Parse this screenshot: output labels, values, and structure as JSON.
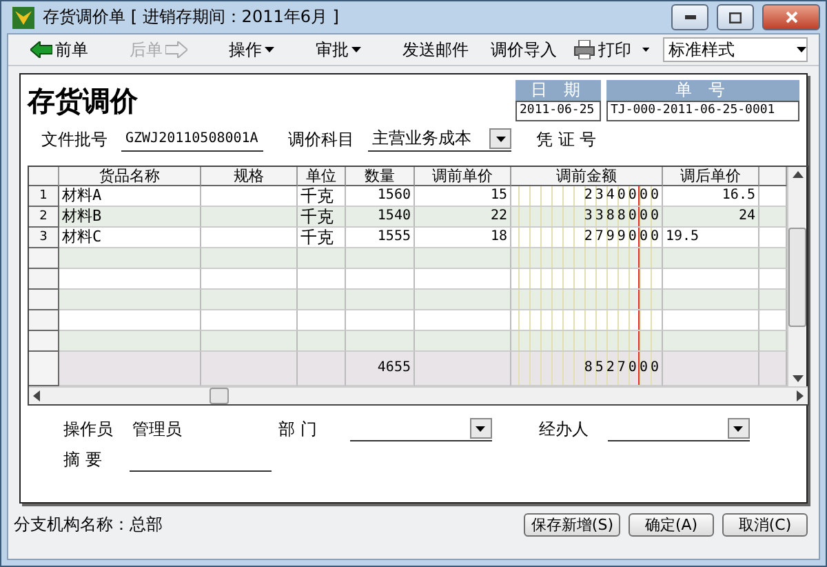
{
  "window": {
    "title": "存货调价单 [ 进销存期间：2011年6月 ]"
  },
  "toolbar": {
    "left": [
      {
        "label": "前单",
        "kind": "prev",
        "disabled": false
      },
      {
        "label": "后单",
        "kind": "next",
        "disabled": true
      },
      {
        "label": "操作",
        "kind": "menu",
        "disabled": false
      },
      {
        "label": "审批",
        "kind": "menu",
        "disabled": false
      },
      {
        "label": "发送邮件",
        "kind": "plain",
        "disabled": false
      }
    ],
    "right": [
      {
        "label": "调价导入",
        "kind": "plain",
        "disabled": false
      },
      {
        "label": "打印",
        "kind": "print",
        "disabled": false
      }
    ],
    "style_select": {
      "value": "标准样式"
    }
  },
  "document": {
    "title": "存货调价",
    "date": {
      "label": "日 期",
      "value": "2011-06-25"
    },
    "number": {
      "label": "单 号",
      "value": "TJ-000-2011-06-25-0001"
    },
    "batch": {
      "label": "文件批号",
      "value": "GZWJ20110508001A"
    },
    "subject": {
      "label": "调价科目",
      "value": "主营业务成本"
    },
    "voucher": {
      "label": "凭 证 号"
    }
  },
  "table": {
    "columns": [
      "货品名称",
      "规格",
      "单位",
      "数量",
      "调前单价",
      "调前金额",
      "调后单价"
    ],
    "rows": [
      {
        "index": "1",
        "name": "材料A",
        "unit": "千克",
        "qty": "1560",
        "price": "15",
        "amount": "2340000",
        "after": "16.5",
        "editing": false
      },
      {
        "index": "2",
        "name": "材料B",
        "unit": "千克",
        "qty": "1540",
        "price": "22",
        "amount": "3388000",
        "after": "24",
        "editing": false
      },
      {
        "index": "3",
        "name": "材料C",
        "unit": "千克",
        "qty": "1555",
        "price": "18",
        "amount": "2799000",
        "after": "19.5",
        "editing": true
      }
    ],
    "totals": {
      "qty": "4655",
      "amount": "8527000"
    }
  },
  "footer": {
    "operator": {
      "label": "操作员",
      "value": "管理员"
    },
    "department": {
      "label": "部 门"
    },
    "handler": {
      "label": "经办人"
    },
    "summary": {
      "label": "摘 要"
    }
  },
  "status_bar": {
    "branch": "分支机构名称：总部",
    "buttons": [
      "保存新增(S)",
      "确定(A)",
      "取消(C)"
    ]
  }
}
